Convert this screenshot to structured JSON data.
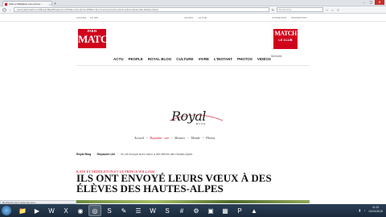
{
  "browser": {
    "tab_title": "Kate et Middleton et le prince...",
    "tab_close": "×",
    "new_tab": "+",
    "url": "www.parismatch.com/Royal-Blog/Royaume-Uni/Kate-et-le-prince-William-ils-ont-envoye-leurs-voeux-a-des-eleves-des-Hautes-Alpes",
    "search_placeholder": "Rechercher",
    "window_controls": [
      "–",
      "▢",
      "✕"
    ]
  },
  "site": {
    "top_left": [
      "ACCUEIL",
      "LE JDD",
      "..."
    ],
    "top_mid": [
      "LE MAG",
      "LE LIVE"
    ],
    "top_right": [
      "CONNEXION",
      "INSCRIPTION"
    ],
    "logo_left_small": "PARIS",
    "logo_left_big": "MATCH",
    "logo_right_big": "MATCH",
    "logo_right_small": "LE CLUB",
    "nav": [
      "ACTU",
      "PEOPLE",
      "ROYAL BLOG",
      "CULTURE",
      "VIVRE",
      "L'INSTANT",
      "PHOTOS",
      "VIDÉOS"
    ],
    "nav_extra": "Services",
    "royal_word": "Royal",
    "royal_blog": "BLOG",
    "subnav": [
      "Accueil",
      "Royaume - uni",
      "Monaco",
      "Monde",
      "Photos"
    ],
    "breadcrumb": [
      "Royal Blog",
      "Royaume-Uni",
      "Ils ont envoyé leurs vœux à des élèves des Hautes-Alpes"
    ],
    "tagline": "Kate et Middleton et le prince William",
    "headline": "Ils ont envoyé leurs vœux à des élèves des Hautes-Alpes",
    "status": "Recherche de fr.nelsonite.com..."
  },
  "taskbar": {
    "clock_time": "11:21",
    "clock_date": "01/01/2015"
  },
  "colors": {
    "accent": "#d0021b"
  }
}
